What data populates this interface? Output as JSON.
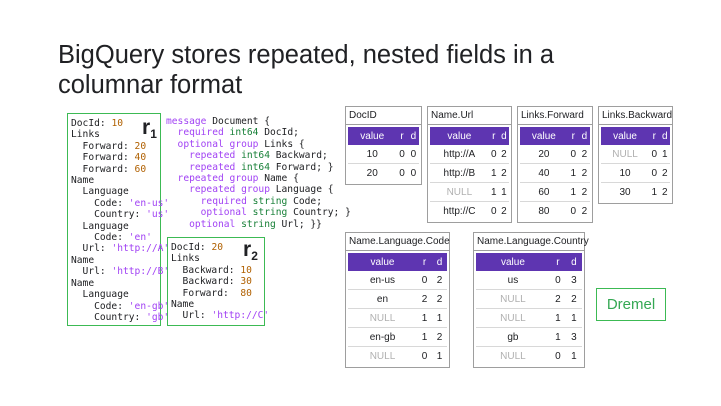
{
  "title": {
    "line1": "BigQuery stores repeated, nested fields in a",
    "line2": "columnar format"
  },
  "records": {
    "r1": {
      "label": "r",
      "sub": "1",
      "lines": [
        [
          [
            "DocId: ",
            ""
          ],
          [
            "10",
            "num"
          ]
        ],
        [
          [
            "Links",
            ""
          ]
        ],
        [
          [
            "  Forward: ",
            ""
          ],
          [
            "20",
            "num"
          ]
        ],
        [
          [
            "  Forward: ",
            ""
          ],
          [
            "40",
            "num"
          ]
        ],
        [
          [
            "  Forward: ",
            ""
          ],
          [
            "60",
            "num"
          ]
        ],
        [
          [
            "Name",
            ""
          ]
        ],
        [
          [
            "  Language",
            ""
          ]
        ],
        [
          [
            "    Code: ",
            ""
          ],
          [
            "'en-us'",
            "str"
          ]
        ],
        [
          [
            "    Country: ",
            ""
          ],
          [
            "'us'",
            "str"
          ]
        ],
        [
          [
            "  Language",
            ""
          ]
        ],
        [
          [
            "    Code: ",
            ""
          ],
          [
            "'en'",
            "str"
          ]
        ],
        [
          [
            "  Url: ",
            ""
          ],
          [
            "'http://A'",
            "str"
          ]
        ],
        [
          [
            "Name",
            ""
          ]
        ],
        [
          [
            "  Url: ",
            ""
          ],
          [
            "'http://B'",
            "str"
          ]
        ],
        [
          [
            "Name",
            ""
          ]
        ],
        [
          [
            "  Language",
            ""
          ]
        ],
        [
          [
            "    Code: ",
            ""
          ],
          [
            "'en-gb'",
            "str"
          ]
        ],
        [
          [
            "    Country: ",
            ""
          ],
          [
            "'gb'",
            "str"
          ]
        ]
      ]
    },
    "r2": {
      "label": "r",
      "sub": "2",
      "lines": [
        [
          [
            "DocId: ",
            ""
          ],
          [
            "20",
            "num"
          ]
        ],
        [
          [
            "Links",
            ""
          ]
        ],
        [
          [
            "  Backward: ",
            ""
          ],
          [
            "10",
            "num"
          ]
        ],
        [
          [
            "  Backward: ",
            ""
          ],
          [
            "30",
            "num"
          ]
        ],
        [
          [
            "  Forward:  ",
            ""
          ],
          [
            "80",
            "num"
          ]
        ],
        [
          [
            "Name",
            ""
          ]
        ],
        [
          [
            "  Url: ",
            ""
          ],
          [
            "'http://C'",
            "str"
          ]
        ]
      ]
    }
  },
  "schema": {
    "lines": [
      [
        [
          "message",
          "kw"
        ],
        [
          " Document {",
          ""
        ]
      ],
      [
        [
          "  required",
          "kw"
        ],
        [
          " ",
          ""
        ],
        [
          "int64",
          "ty"
        ],
        [
          " DocId;",
          ""
        ]
      ],
      [
        [
          "  optional",
          "kw"
        ],
        [
          " ",
          ""
        ],
        [
          "group",
          "kw"
        ],
        [
          " Links {",
          ""
        ]
      ],
      [
        [
          "    repeated",
          "kw"
        ],
        [
          " ",
          ""
        ],
        [
          "int64",
          "ty"
        ],
        [
          " Backward;",
          ""
        ]
      ],
      [
        [
          "    repeated",
          "kw"
        ],
        [
          " ",
          ""
        ],
        [
          "int64",
          "ty"
        ],
        [
          " Forward; }",
          ""
        ]
      ],
      [
        [
          "  repeated",
          "kw"
        ],
        [
          " ",
          ""
        ],
        [
          "group",
          "kw"
        ],
        [
          " Name {",
          ""
        ]
      ],
      [
        [
          "    repeated",
          "kw"
        ],
        [
          " ",
          ""
        ],
        [
          "group",
          "kw"
        ],
        [
          " Language {",
          ""
        ]
      ],
      [
        [
          "      required",
          "kw"
        ],
        [
          " ",
          ""
        ],
        [
          "string",
          "ty"
        ],
        [
          " Code;",
          ""
        ]
      ],
      [
        [
          "      optional",
          "kw"
        ],
        [
          " ",
          ""
        ],
        [
          "string",
          "ty"
        ],
        [
          " Country; }",
          ""
        ]
      ],
      [
        [
          "    optional",
          "kw"
        ],
        [
          " ",
          ""
        ],
        [
          "string",
          "ty"
        ],
        [
          " Url; }}",
          ""
        ]
      ]
    ]
  },
  "columns": [
    {
      "id": "docid",
      "name": "DocID",
      "headers": [
        "value",
        "r",
        "d"
      ],
      "rows": [
        [
          "10",
          "0",
          "0"
        ],
        [
          "20",
          "0",
          "0"
        ]
      ]
    },
    {
      "id": "name-url",
      "name": "Name.Url",
      "headers": [
        "value",
        "r",
        "d"
      ],
      "rows": [
        [
          "http://A",
          "0",
          "2"
        ],
        [
          "http://B",
          "1",
          "2"
        ],
        [
          "NULL",
          "1",
          "1"
        ],
        [
          "http://C",
          "0",
          "2"
        ]
      ]
    },
    {
      "id": "links-forward",
      "name": "Links.Forward",
      "headers": [
        "value",
        "r",
        "d"
      ],
      "rows": [
        [
          "20",
          "0",
          "2"
        ],
        [
          "40",
          "1",
          "2"
        ],
        [
          "60",
          "1",
          "2"
        ],
        [
          "80",
          "0",
          "2"
        ]
      ]
    },
    {
      "id": "links-backward",
      "name": "Links.Backward",
      "headers": [
        "value",
        "r",
        "d"
      ],
      "rows": [
        [
          "NULL",
          "0",
          "1"
        ],
        [
          "10",
          "0",
          "2"
        ],
        [
          "30",
          "1",
          "2"
        ]
      ]
    },
    {
      "id": "name-language-code",
      "name": "Name.Language.Code",
      "headers": [
        "value",
        "r",
        "d"
      ],
      "rows": [
        [
          "en-us",
          "0",
          "2"
        ],
        [
          "en",
          "2",
          "2"
        ],
        [
          "NULL",
          "1",
          "1"
        ],
        [
          "en-gb",
          "1",
          "2"
        ],
        [
          "NULL",
          "0",
          "1"
        ]
      ]
    },
    {
      "id": "name-language-country",
      "name": "Name.Language.Country",
      "headers": [
        "value",
        "r",
        "d"
      ],
      "rows": [
        [
          "us",
          "0",
          "3"
        ],
        [
          "NULL",
          "2",
          "2"
        ],
        [
          "NULL",
          "1",
          "1"
        ],
        [
          "gb",
          "1",
          "3"
        ],
        [
          "NULL",
          "0",
          "1"
        ]
      ]
    }
  ],
  "dremel_label": "Dremel",
  "colors": {
    "header_bg": "#5e35b1",
    "record_border": "#3cba54",
    "dremel": "#34a853",
    "keyword": "#a142f4",
    "type": "#188038",
    "number": "#b06000",
    "null_text": "#b0b0b0"
  }
}
